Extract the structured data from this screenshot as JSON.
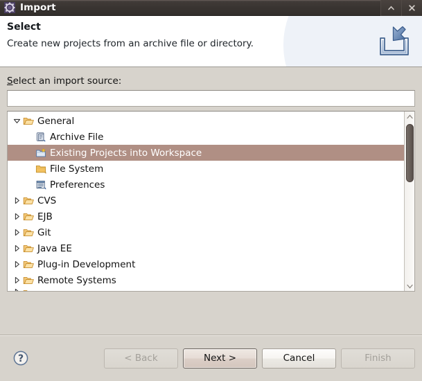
{
  "window": {
    "title": "Import",
    "icon": "eclipse-wizard-icon",
    "controls": [
      {
        "name": "shade-button",
        "glyph": "chevron-up-icon"
      },
      {
        "name": "close-button",
        "glyph": "close-icon"
      }
    ]
  },
  "banner": {
    "title": "Select",
    "subtitle": "Create new projects from an archive file or directory.",
    "icon": "import-inbox-icon"
  },
  "form": {
    "source_label_underlined": "S",
    "source_label_rest": "elect an import source:",
    "filter_value": "",
    "filter_placeholder": ""
  },
  "tree": {
    "items": [
      {
        "label": "General",
        "level": 0,
        "twisty": "expanded",
        "icon": "folder-open-icon",
        "selected": false
      },
      {
        "label": "Archive File",
        "level": 1,
        "twisty": "none",
        "icon": "archive-file-icon",
        "selected": false
      },
      {
        "label": "Existing Projects into Workspace",
        "level": 1,
        "twisty": "none",
        "icon": "project-import-icon",
        "selected": true
      },
      {
        "label": "File System",
        "level": 1,
        "twisty": "none",
        "icon": "folder-closed-icon",
        "selected": false
      },
      {
        "label": "Preferences",
        "level": 1,
        "twisty": "none",
        "icon": "preferences-icon",
        "selected": false
      },
      {
        "label": "CVS",
        "level": 0,
        "twisty": "collapsed",
        "icon": "folder-open-icon",
        "selected": false
      },
      {
        "label": "EJB",
        "level": 0,
        "twisty": "collapsed",
        "icon": "folder-open-icon",
        "selected": false
      },
      {
        "label": "Git",
        "level": 0,
        "twisty": "collapsed",
        "icon": "folder-open-icon",
        "selected": false
      },
      {
        "label": "Java EE",
        "level": 0,
        "twisty": "collapsed",
        "icon": "folder-open-icon",
        "selected": false
      },
      {
        "label": "Plug-in Development",
        "level": 0,
        "twisty": "collapsed",
        "icon": "folder-open-icon",
        "selected": false
      },
      {
        "label": "Remote Systems",
        "level": 0,
        "twisty": "collapsed",
        "icon": "folder-open-icon",
        "selected": false
      }
    ],
    "scrollbar": {
      "up": "scroll-up-icon",
      "down": "scroll-down-icon"
    }
  },
  "footer": {
    "help": "?",
    "buttons": [
      {
        "name": "back-button",
        "label": "< Back",
        "mnemonic": "B",
        "state": "disabled"
      },
      {
        "name": "next-button",
        "label": "Next >",
        "mnemonic": "N",
        "state": "default"
      },
      {
        "name": "cancel-button",
        "label": "Cancel",
        "mnemonic": "",
        "state": "enabled"
      },
      {
        "name": "finish-button",
        "label": "Finish",
        "mnemonic": "F",
        "state": "disabled"
      }
    ]
  },
  "colors": {
    "titlebar": "#393431",
    "dialog_bg": "#d7d3cc",
    "selection": "#b08f84",
    "accent_blue": "#5a7fae"
  }
}
